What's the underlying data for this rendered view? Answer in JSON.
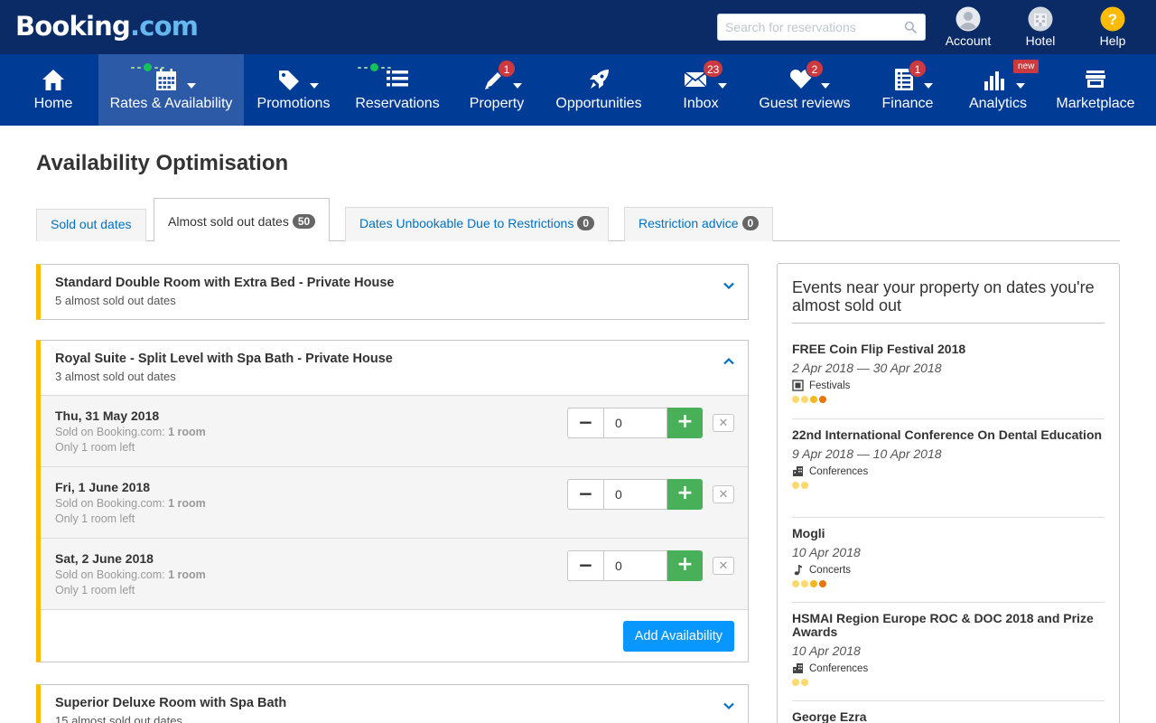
{
  "header": {
    "logo_main": "Booking",
    "logo_suffix": ".com",
    "search_placeholder": "Search for reservations",
    "tools": [
      {
        "label": "Account",
        "icon": "user-icon"
      },
      {
        "label": "Hotel",
        "icon": "hotel-icon"
      },
      {
        "label": "Help",
        "icon": "question-icon"
      }
    ]
  },
  "nav": {
    "items": [
      {
        "label": "Home",
        "icon": "home-icon",
        "active": false
      },
      {
        "label": "Rates & Availability",
        "icon": "calendar-icon",
        "active": true
      },
      {
        "label": "Promotions",
        "icon": "tag-icon",
        "active": false
      },
      {
        "label": "Reservations",
        "icon": "list-icon",
        "active": false
      },
      {
        "label": "Property",
        "icon": "pencil-icon",
        "badge": "1",
        "active": false
      },
      {
        "label": "Opportunities",
        "icon": "rocket-icon",
        "active": false
      },
      {
        "label": "Inbox",
        "icon": "envelope-icon",
        "badge": "23",
        "active": false
      },
      {
        "label": "Guest reviews",
        "icon": "heart-icon",
        "badge": "2",
        "active": false
      },
      {
        "label": "Finance",
        "icon": "document-icon",
        "badge": "1",
        "active": false
      },
      {
        "label": "Analytics",
        "icon": "bar-chart-icon",
        "tag": "new",
        "active": false
      },
      {
        "label": "Marketplace",
        "icon": "store-icon",
        "active": false
      }
    ]
  },
  "page": {
    "title": "Availability Optimisation",
    "tabs": [
      {
        "label": "Sold out dates",
        "count": null,
        "active": false
      },
      {
        "label": "Almost sold out dates",
        "count": "50",
        "active": true
      },
      {
        "label": "Dates Unbookable Due to Restrictions",
        "count": "0",
        "active": false
      },
      {
        "label": "Restriction advice",
        "count": "0",
        "active": false
      }
    ]
  },
  "rooms": [
    {
      "title": "Standard Double Room with Extra Bed - Private House",
      "subtitle": "5 almost sold out dates",
      "expanded": false
    },
    {
      "title": "Royal Suite - Split Level with Spa Bath - Private House",
      "subtitle": "3 almost sold out dates",
      "expanded": true,
      "dates": [
        {
          "date": "Thu, 31 May 2018",
          "sold_prefix": "Sold on Booking.com:",
          "sold_value": "1 room",
          "left": "Only 1 room left",
          "value": "0"
        },
        {
          "date": "Fri, 1 June 2018",
          "sold_prefix": "Sold on Booking.com:",
          "sold_value": "1 room",
          "left": "Only 1 room left",
          "value": "0"
        },
        {
          "date": "Sat, 2 June 2018",
          "sold_prefix": "Sold on Booking.com:",
          "sold_value": "1 room",
          "left": "Only 1 room left",
          "value": "0"
        }
      ],
      "add_button": "Add Availability"
    },
    {
      "title": "Superior Deluxe Room with Spa Bath",
      "subtitle": "15 almost sold out dates",
      "expanded": false
    }
  ],
  "events": {
    "title": "Events near your property on dates you're almost sold out",
    "items": [
      {
        "name": "FREE Coin Flip Festival 2018",
        "dates": "2 Apr 2018 — 30 Apr 2018",
        "category": "Festivals",
        "icon": "festival-icon",
        "popularity": 4
      },
      {
        "name": "22nd International Conference On Dental Education",
        "dates": "9 Apr 2018 — 10 Apr 2018",
        "category": "Conferences",
        "icon": "building-icon",
        "popularity": 2
      },
      {
        "name": "Mogli",
        "dates": "10 Apr 2018",
        "category": "Concerts",
        "icon": "music-note-icon",
        "popularity": 4
      },
      {
        "name": "HSMAI Region Europe ROC & DOC 2018 and Prize Awards",
        "dates": "10 Apr 2018",
        "category": "Conferences",
        "icon": "building-icon",
        "popularity": 2
      },
      {
        "name": "George Ezra",
        "dates": "",
        "category": "",
        "icon": "",
        "popularity": 0
      }
    ]
  },
  "colors": {
    "header_bg": "#0b2b66",
    "nav_bg": "#003b95",
    "nav_active": "#2d5aa6",
    "accent_blue": "#0071c2",
    "button_blue": "#0896ff",
    "plus_green": "#49b05a",
    "panel_stripe": "#febb02",
    "badge_red": "#cc3a3f",
    "dot_light": "#fcd96c",
    "dot_mid": "#f4b81d",
    "dot_dark": "#e8740f"
  }
}
